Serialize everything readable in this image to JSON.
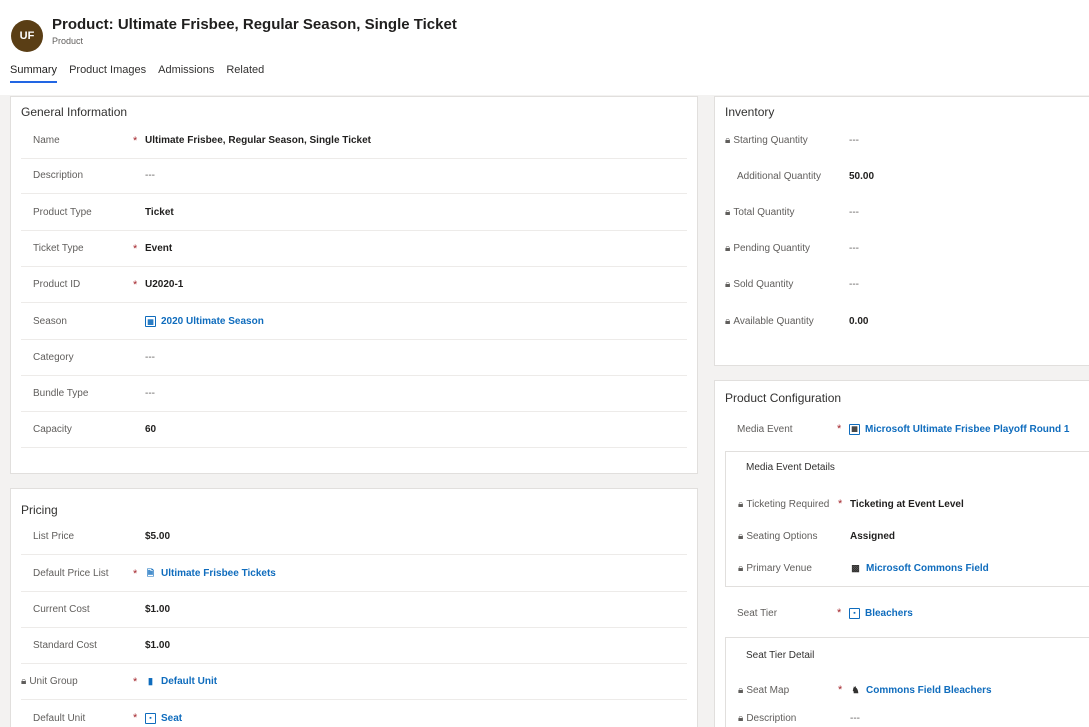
{
  "header": {
    "initials": "UF",
    "title": "Product: Ultimate Frisbee, Regular Season, Single Ticket",
    "entity": "Product"
  },
  "tabs": [
    "Summary",
    "Product Images",
    "Admissions",
    "Related"
  ],
  "general": {
    "title": "General Information",
    "fields": [
      {
        "label": "Name",
        "required": "*",
        "value": "Ultimate Frisbee, Regular Season, Single Ticket"
      },
      {
        "label": "Description",
        "required": "",
        "value": "---"
      },
      {
        "label": "Product Type",
        "required": "",
        "value": "Ticket"
      },
      {
        "label": "Ticket Type",
        "required": "*",
        "value": "Event"
      },
      {
        "label": "Product ID",
        "required": "*",
        "value": "U2020-1"
      },
      {
        "label": "Season",
        "required": "",
        "value": "2020 Ultimate Season",
        "icon": "calendar-icon"
      },
      {
        "label": "Category",
        "required": "",
        "value": "---"
      },
      {
        "label": "Bundle Type",
        "required": "",
        "value": "---"
      },
      {
        "label": "Capacity",
        "required": "",
        "value": "60"
      }
    ]
  },
  "pricing": {
    "title": "Pricing",
    "fields": [
      {
        "label": "List Price",
        "required": "",
        "value": "$5.00"
      },
      {
        "label": "Default Price List",
        "required": "*",
        "value": "Ultimate Frisbee Tickets",
        "icon": "price-list-icon"
      },
      {
        "label": "Current Cost",
        "required": "",
        "value": "$1.00"
      },
      {
        "label": "Standard Cost",
        "required": "",
        "value": "$1.00"
      },
      {
        "label": "Unit Group",
        "required": "*",
        "value": "Default Unit",
        "icon": "unit-group-icon",
        "locked": true
      },
      {
        "label": "Default Unit",
        "required": "*",
        "value": "Seat",
        "icon": "unit-icon"
      }
    ]
  },
  "inventory": {
    "title": "Inventory",
    "fields": [
      {
        "label": "Starting Quantity",
        "value": "---",
        "locked": true
      },
      {
        "label": "Additional Quantity",
        "value": "50.00",
        "locked": false
      },
      {
        "label": "Total Quantity",
        "value": "---",
        "locked": true
      },
      {
        "label": "Pending Quantity",
        "value": "---",
        "locked": true
      },
      {
        "label": "Sold Quantity",
        "value": "---",
        "locked": true
      },
      {
        "label": "Available Quantity",
        "value": "0.00",
        "locked": true
      }
    ]
  },
  "config": {
    "title": "Product Configuration",
    "media_event_label": "Media Event",
    "media_event_required": "*",
    "media_event_value": "Microsoft Ultimate Frisbee Playoff Round 1",
    "media_details_title": "Media Event Details",
    "media_details": [
      {
        "label": "Ticketing Required",
        "required": "*",
        "value": "Ticketing at Event Level"
      },
      {
        "label": "Seating Options",
        "required": "",
        "value": "Assigned"
      },
      {
        "label": "Primary Venue",
        "required": "",
        "value": "Microsoft Commons Field"
      }
    ],
    "seat_tier_label": "Seat Tier",
    "seat_tier_required": "*",
    "seat_tier_value": "Bleachers",
    "seat_tier_detail_title": "Seat Tier Detail",
    "seat_tier_details": [
      {
        "label": "Seat Map",
        "required": "*",
        "value": "Commons Field Bleachers"
      },
      {
        "label": "Description",
        "required": "",
        "value": "---"
      }
    ]
  },
  "colors": {
    "accent": "#2266e3",
    "link": "#0f6cbd",
    "required": "#a4262c",
    "avatar": "#5a3e15"
  }
}
